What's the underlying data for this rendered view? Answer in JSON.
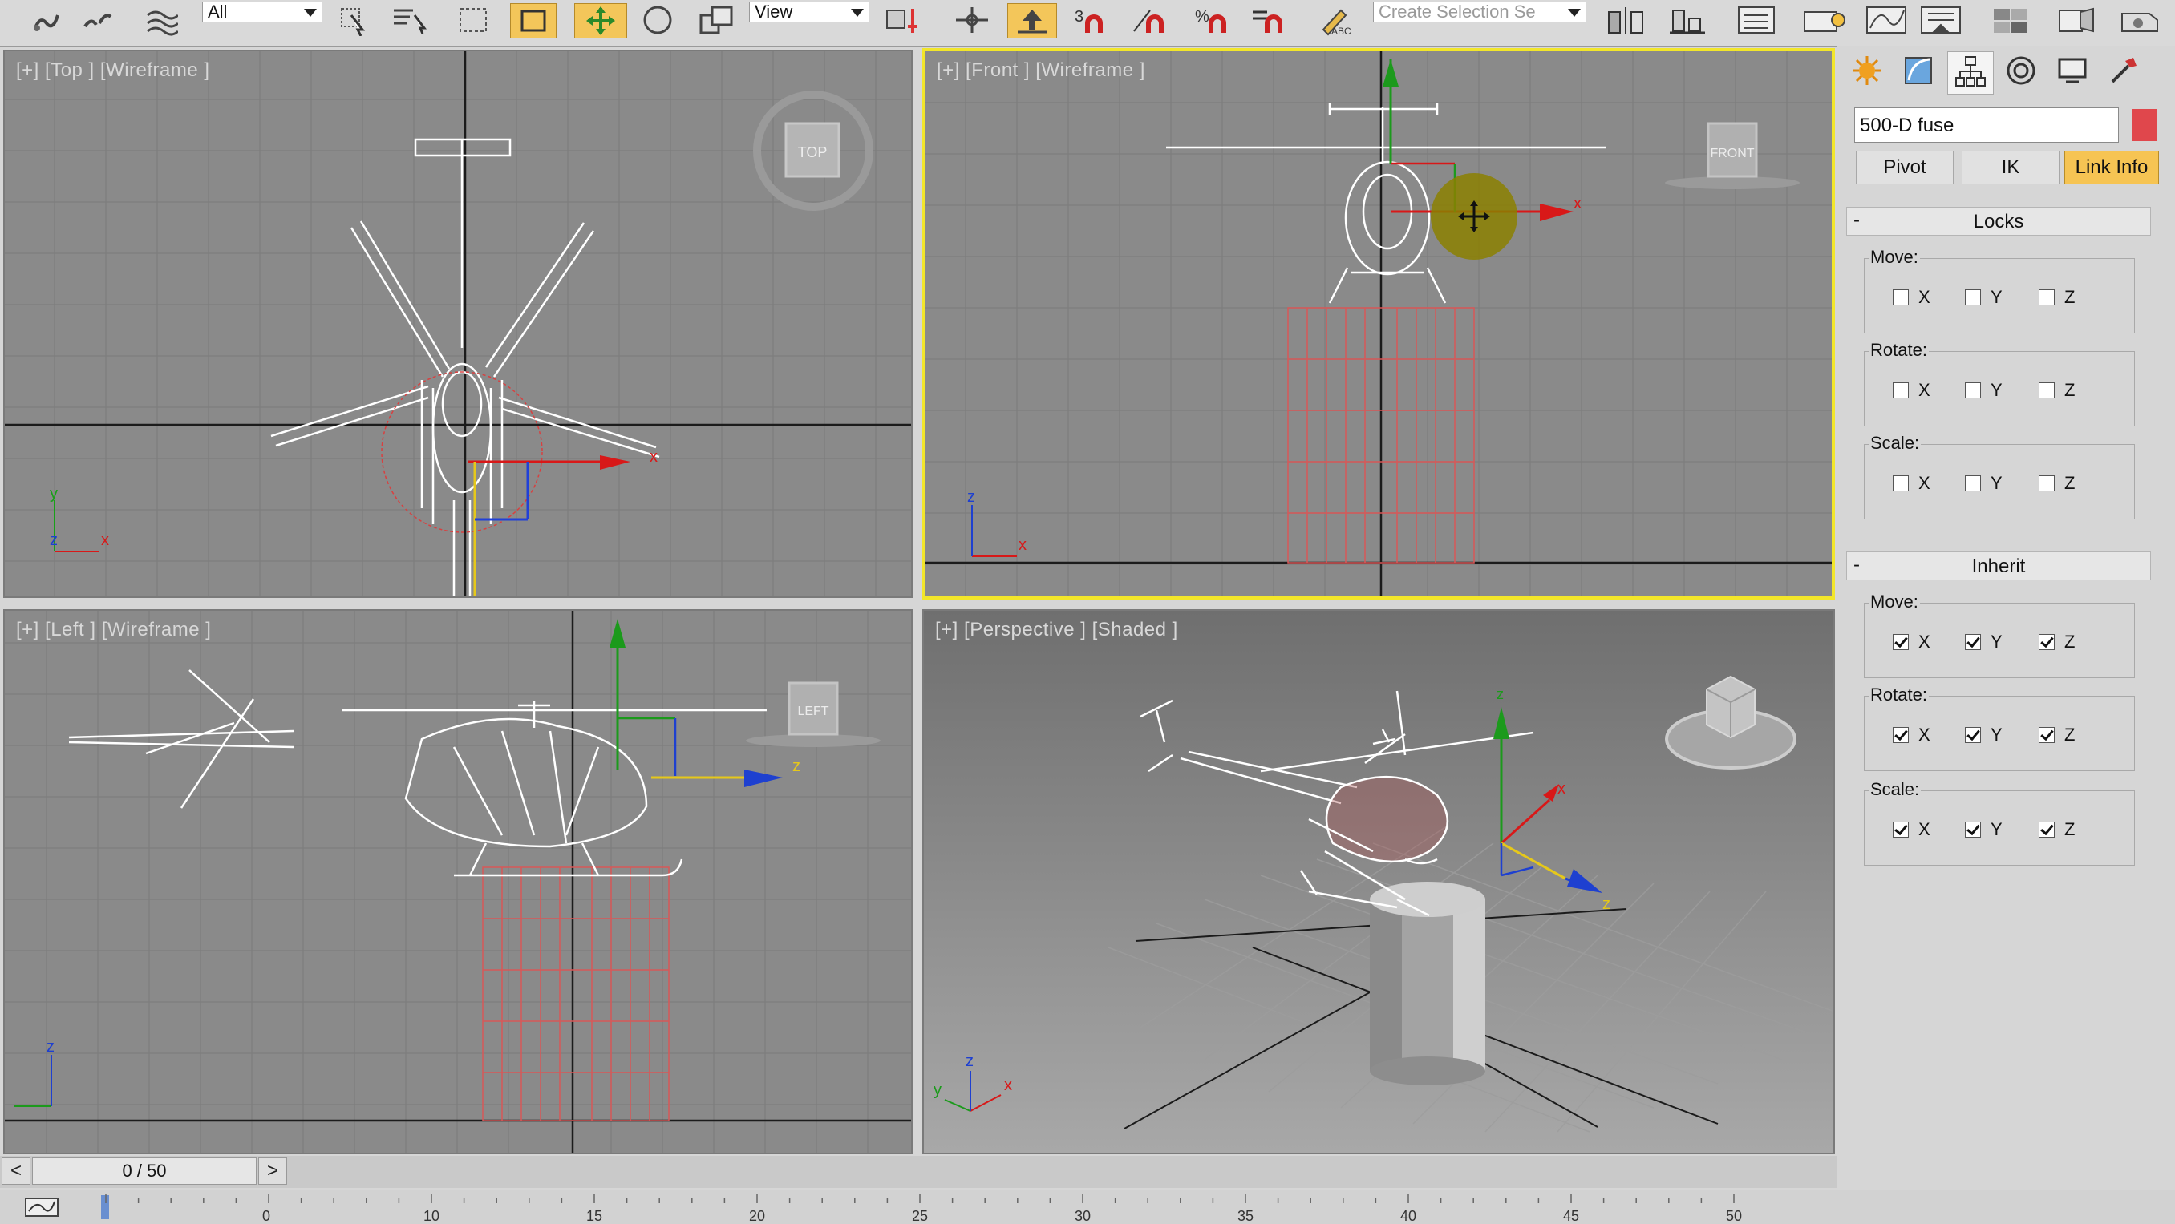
{
  "toolbar": {
    "selection_filter": "All",
    "ref_coord": "View",
    "named_selection_placeholder": "Create Selection Se"
  },
  "viewports": {
    "top": {
      "label": "[+] [Top ] [Wireframe ]",
      "cube_label": "TOP"
    },
    "front": {
      "label": "[+] [Front ] [Wireframe ]",
      "cube_label": "FRONT"
    },
    "left": {
      "label": "[+] [Left ] [Wireframe ]",
      "cube_label": "LEFT"
    },
    "perspective": {
      "label": "[+] [Perspective ] [Shaded ]"
    }
  },
  "axes": {
    "x": "x",
    "y": "y",
    "z": "z"
  },
  "command_panel": {
    "tabs": [
      "create-icon",
      "modify-icon",
      "hierarchy-icon",
      "motion-icon",
      "display-icon",
      "utilities-icon"
    ],
    "object_name": "500-D fuse",
    "object_color": "#e0474c",
    "buttons": {
      "pivot": "Pivot",
      "ik": "IK",
      "link_info": "Link Info"
    },
    "locks": {
      "title": "Locks",
      "collapse": "-",
      "move": "Move:",
      "rotate": "Rotate:",
      "scale": "Scale:"
    },
    "inherit": {
      "title": "Inherit",
      "collapse": "-",
      "move": "Move:",
      "rotate": "Rotate:",
      "scale": "Scale:"
    },
    "checkbox_labels": {
      "x": "X",
      "y": "Y",
      "z": "Z"
    },
    "locks_checked": false,
    "inherit_checked": true
  },
  "time_slider": {
    "prev": "<",
    "next": ">",
    "frame": "0 / 50"
  },
  "track_bar": {
    "ticks": [
      "0",
      "10",
      "15",
      "20",
      "25",
      "30",
      "35",
      "40",
      "45",
      "50"
    ]
  }
}
